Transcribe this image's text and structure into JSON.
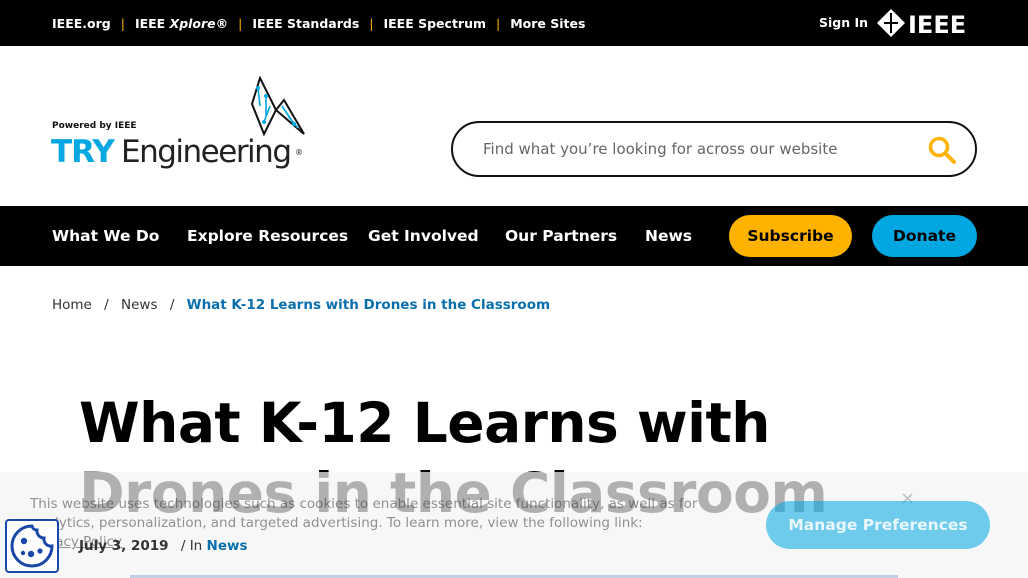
{
  "topbar": {
    "links": [
      {
        "label": "IEEE.org"
      },
      {
        "label_pre": "IEEE ",
        "label_em": "Xplore",
        "label_post": "®"
      },
      {
        "label": "IEEE Standards"
      },
      {
        "label": "IEEE Spectrum"
      },
      {
        "label": "More Sites"
      }
    ],
    "separator": "|",
    "sign_in": "Sign In",
    "brand": "IEEE"
  },
  "logo": {
    "powered_by": "Powered by IEEE",
    "try": "TRY",
    "engineering": "Engineering",
    "registered": "®"
  },
  "search": {
    "placeholder": "Find what you’re looking for across our website",
    "value": "",
    "icon": "search-icon"
  },
  "nav": {
    "items": [
      "What We Do",
      "Explore Resources",
      "Get Involved",
      "Our Partners",
      "News"
    ],
    "subscribe": "Subscribe",
    "donate": "Donate"
  },
  "breadcrumb": {
    "home": "Home",
    "news": "News",
    "current": "What K-12 Learns with Drones in the Classroom",
    "separator": "/"
  },
  "article": {
    "title": "What K-12 Learns with Drones in the Classroom",
    "date": "July 3, 2019",
    "in_label": "/ In",
    "category": "News"
  },
  "cookie_banner": {
    "text": "This website uses technologies such as cookies to enable essential site functionality, as well as for analytics, personalization, and targeted advertising. To learn more, view the following link:",
    "policy_link": "Privacy Policy",
    "manage_button": "Manage Preferences",
    "close": "×"
  },
  "colors": {
    "accent_yellow": "#ffb300",
    "accent_blue": "#00a7e1",
    "link_blue": "#0a6fae",
    "bar_black": "#000000"
  }
}
